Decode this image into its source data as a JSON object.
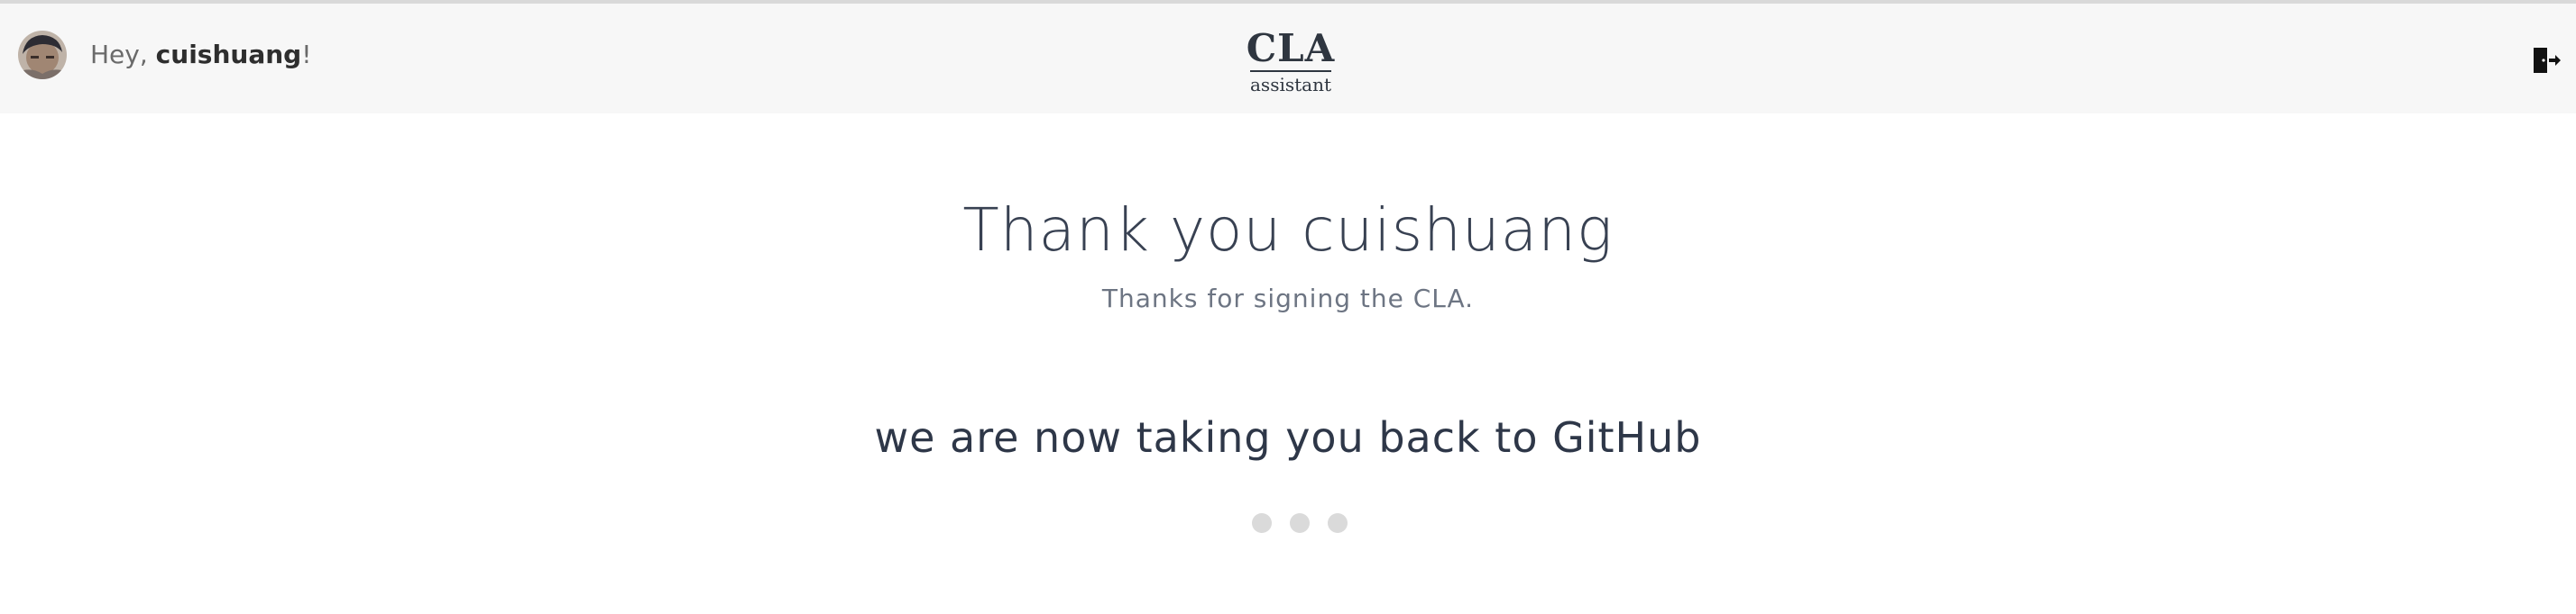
{
  "header": {
    "greeting_prefix": "Hey, ",
    "username": "cuishuang",
    "greeting_suffix": "!",
    "logo": {
      "title": "CLA",
      "subtitle": "assistant"
    },
    "avatar_icon": "user-avatar-photo",
    "signout_icon": "sign-out-door-icon"
  },
  "main": {
    "title": "Thank you cuishuang",
    "subtitle": "Thanks for signing the CLA.",
    "redirect_message": "we are now taking you back to GitHub",
    "loading_dots": 3
  },
  "colors": {
    "header_bg": "#f7f7f7",
    "text_dark": "#2e3748",
    "text_muted": "#6d7583",
    "dot": "#dadada"
  }
}
